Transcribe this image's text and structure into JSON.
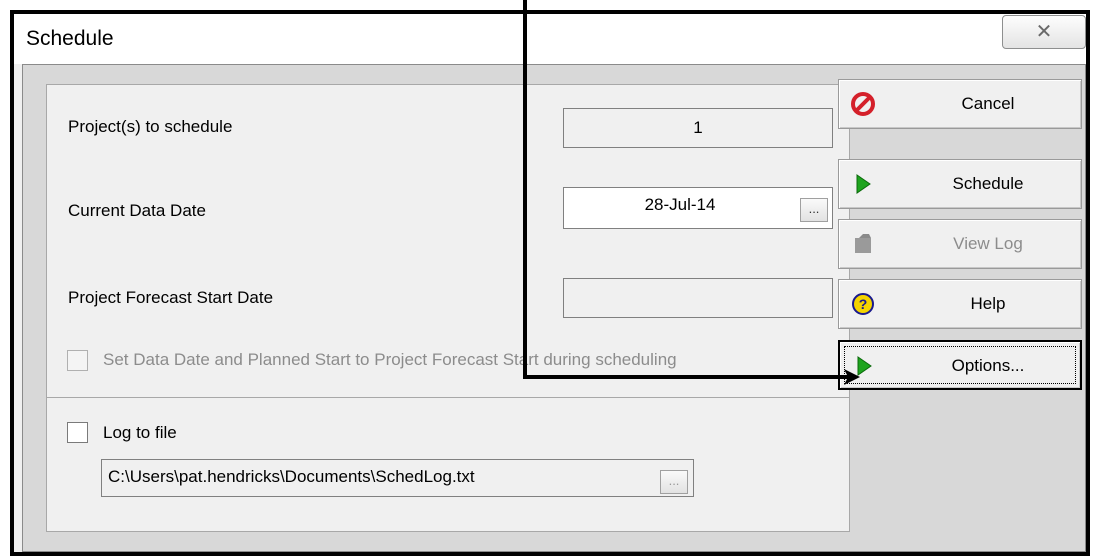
{
  "window": {
    "title": "Schedule",
    "close_glyph": "✕"
  },
  "fields": {
    "projects_label": "Project(s) to schedule",
    "projects_value": "1",
    "data_date_label": "Current Data Date",
    "data_date_value": "28-Jul-14",
    "forecast_label": "Project Forecast Start Date",
    "forecast_value": "",
    "set_data_date_label": "Set Data Date and Planned Start to Project Forecast Start during scheduling",
    "log_to_file_label": "Log to file",
    "log_path": "C:\\Users\\pat.hendricks\\Documents\\SchedLog.txt",
    "ellipsis": "..."
  },
  "buttons": {
    "cancel": "Cancel",
    "schedule": "Schedule",
    "view_log": "View Log",
    "help": "Help",
    "options": "Options..."
  },
  "icons": {
    "cancel": "stop-icon",
    "schedule": "play-arrow-icon",
    "view_log": "log-icon",
    "help": "question-icon",
    "options": "play-arrow-icon"
  },
  "colors": {
    "cancel_icon": "#d4202a",
    "play_icon": "#1ea41e",
    "help_icon": "#f4d400",
    "disabled_text": "#8c8c8c"
  }
}
